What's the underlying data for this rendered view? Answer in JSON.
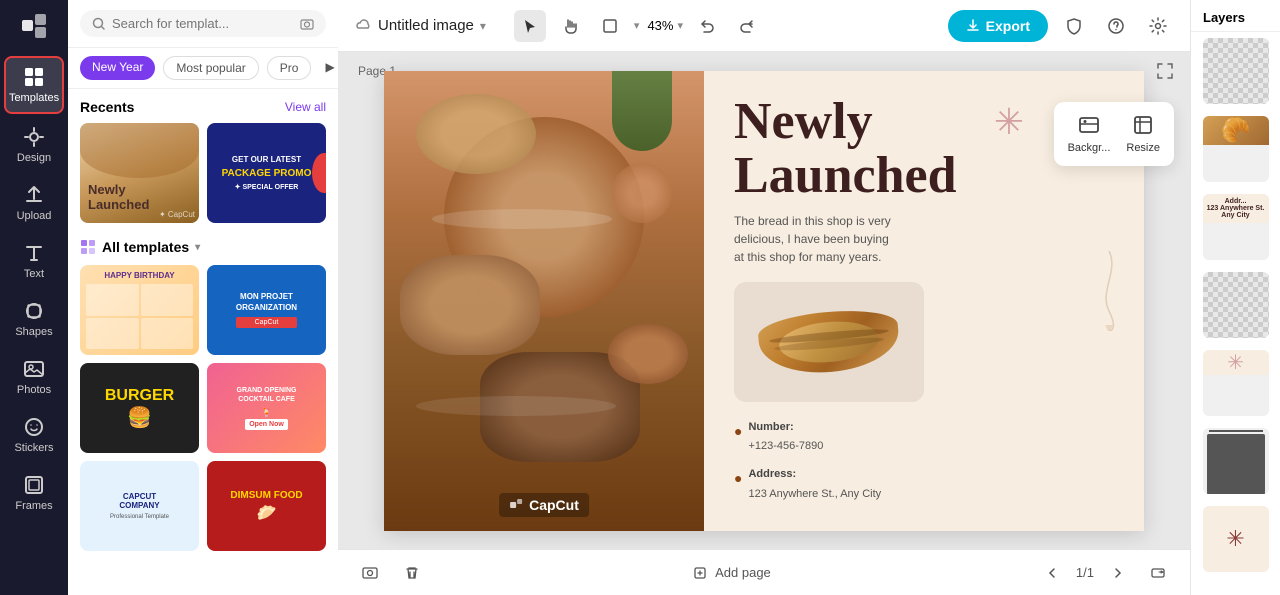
{
  "app": {
    "title": "Untitled image",
    "zoom": "43%",
    "page_label": "Page 1",
    "page_count": "1/1"
  },
  "sidebar": {
    "items": [
      {
        "id": "templates",
        "label": "Templates",
        "active": true
      },
      {
        "id": "design",
        "label": "Design",
        "active": false
      },
      {
        "id": "upload",
        "label": "Upload",
        "active": false
      },
      {
        "id": "text",
        "label": "Text",
        "active": false
      },
      {
        "id": "shapes",
        "label": "Shapes",
        "active": false
      },
      {
        "id": "photos",
        "label": "Photos",
        "active": false
      },
      {
        "id": "stickers",
        "label": "Stickers",
        "active": false
      },
      {
        "id": "frames",
        "label": "Frames",
        "active": false
      }
    ]
  },
  "panel": {
    "search_placeholder": "Search for templat...",
    "tags": [
      "New Year",
      "Most popular",
      "Pro"
    ],
    "recents_label": "Recents",
    "view_all": "View all",
    "all_templates": "All templates",
    "recent_cards": [
      {
        "label": "Newly\nLaunched",
        "type": "bakery"
      },
      {
        "label": "GET OUR LATEST PACKAGE PROMO",
        "type": "promo"
      }
    ],
    "template_cards": [
      {
        "label": "HAPPY BIRTHDAY",
        "type": "birthday"
      },
      {
        "label": "MON PROJET ORGANIZATION",
        "type": "org"
      },
      {
        "label": "BURGER",
        "type": "burger"
      },
      {
        "label": "GRAND OPENING COCKTAIL CAFE",
        "type": "cocktail"
      },
      {
        "label": "CAPCUT COMPANY",
        "type": "capcut"
      },
      {
        "label": "DIMSUM FOOD",
        "type": "dimsum"
      }
    ]
  },
  "canvas": {
    "title_line1": "Newly",
    "title_line2": "Launched",
    "description": "The bread in this shop is very delicious, I have been buying at this shop for many years.",
    "watermark": "CapCut",
    "number_label": "Number:",
    "number_value": "+123-456-7890",
    "address_label": "Address:",
    "address_value": "123 Anywhere St., Any City"
  },
  "toolbar": {
    "export_label": "Export",
    "background_label": "Backgr...",
    "resize_label": "Resize",
    "add_page": "Add page"
  },
  "layers": {
    "title": "Layers"
  }
}
